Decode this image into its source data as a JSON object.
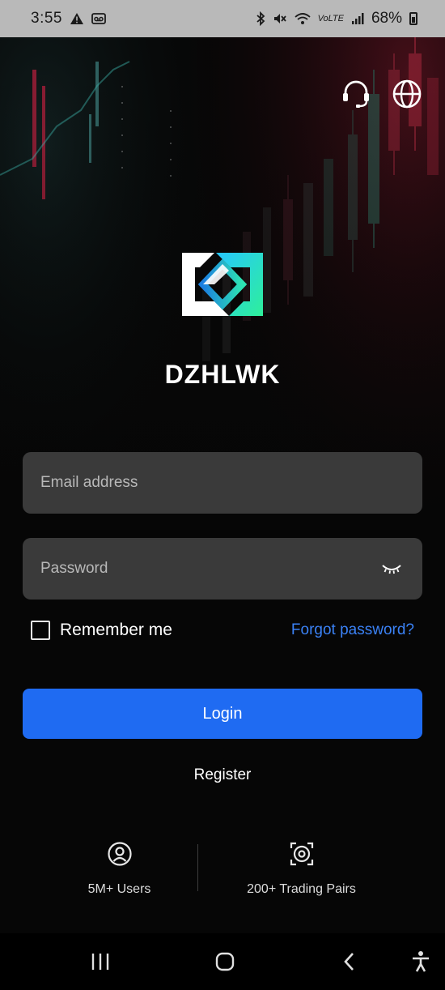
{
  "status_bar": {
    "time": "3:55",
    "carrier_label": "VoLTE",
    "battery_percent": "68%",
    "icons": [
      "warning-icon",
      "voicemail-icon",
      "bluetooth-icon",
      "mute-icon",
      "wifi-icon",
      "signal-icon",
      "battery-icon"
    ]
  },
  "header": {
    "icons": [
      "headset-support-icon",
      "globe-language-icon"
    ]
  },
  "brand": {
    "app_name": "DZHLWK",
    "accent_green": "#2ee59d",
    "accent_blue": "#1f6bf2"
  },
  "form": {
    "email_placeholder": "Email address",
    "email_value": "",
    "password_placeholder": "Password",
    "password_value": "",
    "password_toggle_icon": "eye-closed-icon",
    "remember_label": "Remember me",
    "remember_checked": false,
    "forgot_label": "Forgot password?",
    "login_label": "Login",
    "register_label": "Register"
  },
  "stats": {
    "users_label": "5M+ Users",
    "users_icon": "user-circle-icon",
    "pairs_label": "200+ Trading Pairs",
    "pairs_icon": "trading-pairs-icon"
  },
  "nav_bar": {
    "icons": [
      "recents-icon",
      "home-icon",
      "back-icon",
      "accessibility-icon"
    ]
  }
}
